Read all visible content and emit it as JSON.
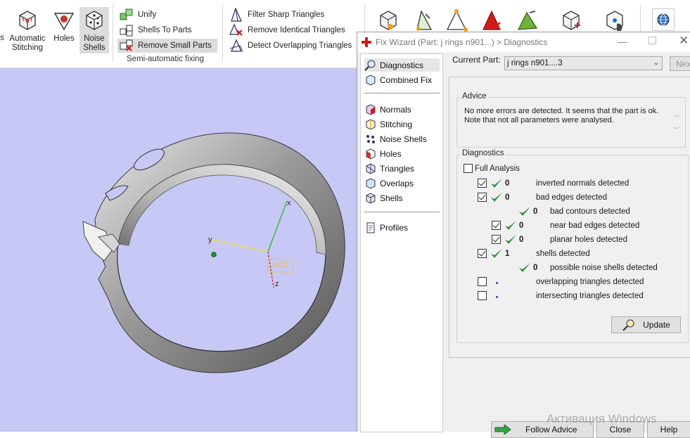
{
  "ribbon": {
    "big_buttons": [
      {
        "label": "s",
        "icon": "automatic-stitching-icon"
      },
      {
        "label": "Automatic\nStitching",
        "icon": "automatic-stitching-icon"
      },
      {
        "label": "Holes",
        "icon": "holes-icon"
      },
      {
        "label": "Noise\nShells",
        "icon": "noise-shells-icon"
      }
    ],
    "semi_auto": {
      "items": [
        "Unify",
        "Shells To Parts",
        "Remove Small Parts"
      ],
      "group_label": "Semi-automatic fixing"
    },
    "triangle_tools": [
      "Filter Sharp Triangles",
      "Remove Identical Triangles",
      "Detect Overlapping Triangles"
    ]
  },
  "viewport": {
    "axes": {
      "x": "x",
      "y": "y",
      "z": "z",
      "ucs": "UCS"
    },
    "background": "#c8c8f6"
  },
  "wizard": {
    "title": "Fix Wizard (Part: j rings n901...) > Diagnostics",
    "nav": {
      "top": [
        "Diagnostics",
        "Combined Fix"
      ],
      "tools": [
        "Normals",
        "Stitching",
        "Noise Shells",
        "Holes",
        "Triangles",
        "Overlaps",
        "Shells"
      ],
      "bottom": [
        "Profiles"
      ]
    },
    "current_part_label": "Current Part:",
    "current_part_value": "j rings n901....3",
    "next_label": "Next",
    "advice": {
      "label": "Advice",
      "text": "No more errors are detected. It seems that the part is ok.\nNote that not all parameters were analysed."
    },
    "diagnostics": {
      "label": "Diagnostics",
      "full_analysis": "Full Analysis",
      "rows": [
        {
          "checked": true,
          "status": "ok",
          "count": "0",
          "text": "inverted normals detected"
        },
        {
          "checked": true,
          "status": "ok",
          "count": "0",
          "text": "bad edges detected"
        },
        {
          "checked": null,
          "status": "ok",
          "count": "0",
          "text": "bad contours detected"
        },
        {
          "checked": true,
          "status": "ok",
          "count": "0",
          "text": "near bad edges detected"
        },
        {
          "checked": true,
          "status": "ok",
          "count": "0",
          "text": "planar holes detected"
        },
        {
          "checked": true,
          "status": "ok",
          "count": "1",
          "text": "shells detected"
        },
        {
          "checked": null,
          "status": "ok",
          "count": "0",
          "text": "possible noise shells detected"
        },
        {
          "checked": false,
          "status": "none",
          "count": "",
          "text": "overlapping triangles detected"
        },
        {
          "checked": false,
          "status": "none",
          "count": "",
          "text": "intersecting triangles detected"
        }
      ],
      "update_label": "Update"
    },
    "footer": {
      "follow_advice": "Follow Advice",
      "close": "Close",
      "help": "Help"
    }
  },
  "watermark": "Активация Windows",
  "colors": {
    "check_green": "#2f8f3a",
    "accent_red": "#d11b1b"
  }
}
